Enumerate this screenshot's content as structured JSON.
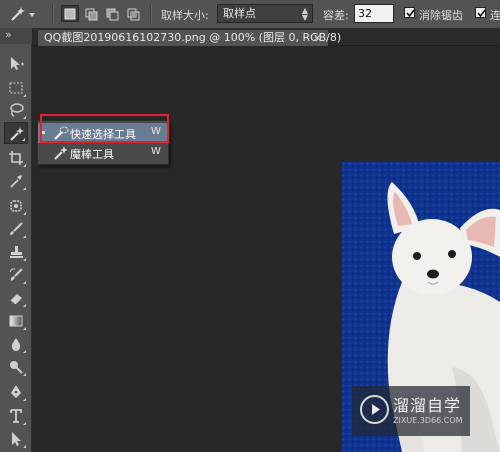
{
  "options_bar": {
    "sample_size_label": "取样大小:",
    "sample_size_value": "取样点",
    "tolerance_label": "容差:",
    "tolerance_value": "32",
    "antialias_label": "消除锯齿",
    "contiguous_label": "连",
    "antialias_checked": true,
    "contiguous_checked": true
  },
  "document_tab": {
    "title": "QQ截图20190616102730.png @ 100% (图层 0, RGB/8)",
    "close_glyph": "×"
  },
  "panel_collapse_glyph": "»",
  "tool_flyout": {
    "items": [
      {
        "label": "快速选择工具",
        "shortcut": "W",
        "selected": true,
        "icon": "quick-selection-icon"
      },
      {
        "label": "魔棒工具",
        "shortcut": "W",
        "selected": false,
        "icon": "magic-wand-icon"
      }
    ]
  },
  "watermark": {
    "title": "溜溜自学",
    "url": "ZIXUE.3D66.COM"
  },
  "colors": {
    "canvas_blue": "#0d2e8c",
    "highlight_red": "#e0232f",
    "flyout_selected": "#6a7c92"
  }
}
